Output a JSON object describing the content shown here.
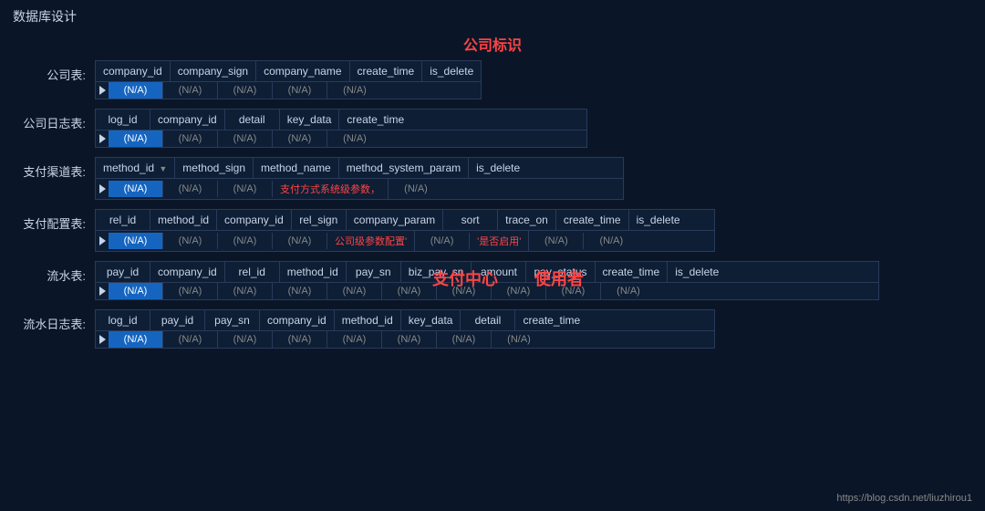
{
  "page": {
    "title": "数据库设计",
    "center_label": "公司标识",
    "footer_url": "https://blog.csdn.net/liuzhirou1"
  },
  "tables": {
    "company": {
      "label": "公司表:",
      "headers": [
        "company_id",
        "company_sign",
        "company_name",
        "create_time",
        "is_delete"
      ],
      "row": [
        "(N/A)",
        "(N/A)",
        "(N/A)",
        "(N/A)",
        "(N/A)"
      ],
      "highlighted": [
        0
      ]
    },
    "company_log": {
      "label": "公司日志表:",
      "headers": [
        "log_id",
        "company_id",
        "detail",
        "key_data",
        "create_time"
      ],
      "row": [
        "(N/A)",
        "(N/A)",
        "(N/A)",
        "(N/A)",
        "(N/A)"
      ],
      "highlighted": [
        0
      ]
    },
    "payment_channel": {
      "label": "支付渠道表:",
      "headers": [
        "method_id",
        "method_sign",
        "method_name",
        "method_system_param",
        "is_delete"
      ],
      "row": [
        "(N/A)",
        "(N/A)",
        "(N/A)",
        "支付方式系统级参数，",
        "(N/A)"
      ],
      "highlighted": [
        0
      ],
      "sort_col": 0
    },
    "payment_config": {
      "label": "支付配置表:",
      "headers": [
        "rel_id",
        "method_id",
        "company_id",
        "rel_sign",
        "company_param",
        "sort",
        "trace_on",
        "create_time",
        "is_delete"
      ],
      "row": [
        "(N/A)",
        "(N/A)",
        "(N/A)",
        "(N/A)",
        "公司级参数配置'",
        "(N/A)",
        "'是否启用'",
        "(N/A)",
        "(N/A)"
      ],
      "highlighted": [
        0
      ]
    },
    "flow": {
      "label": "流水表:",
      "headers": [
        "pay_id",
        "company_id",
        "rel_id",
        "method_id",
        "pay_sn",
        "biz_pay_sn",
        "amount",
        "pay_status",
        "create_time",
        "is_delete"
      ],
      "row": [
        "(N/A)",
        "(N/A)",
        "(N/A)",
        "(N/A)",
        "(N/A)",
        "(N/A)",
        "(N/A)",
        "(N/A)",
        "(N/A)",
        "(N/A)"
      ],
      "highlighted": [
        0
      ],
      "overlap_labels": [
        "支付中心",
        "使用者"
      ]
    },
    "flow_log": {
      "label": "流水日志表:",
      "headers": [
        "log_id",
        "pay_id",
        "pay_sn",
        "company_id",
        "method_id",
        "key_data",
        "detail",
        "create_time"
      ],
      "row": [
        "(N/A)",
        "(N/A)",
        "(N/A)",
        "(N/A)",
        "(N/A)",
        "(N/A)",
        "(N/A)",
        "(N/A)"
      ],
      "highlighted": [
        0
      ]
    }
  }
}
